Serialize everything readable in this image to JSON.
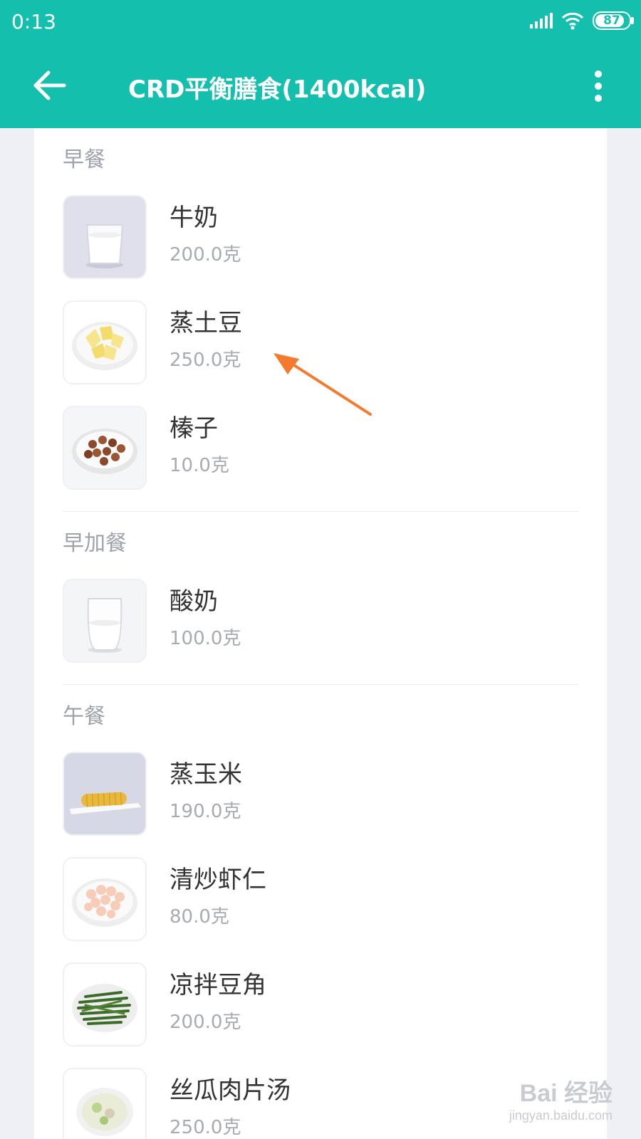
{
  "status_bar": {
    "time": "0:13",
    "battery": "87",
    "icons": [
      "signal-icon",
      "wifi-icon",
      "battery-icon"
    ]
  },
  "app_bar": {
    "title": "CRD平衡膳食(1400kcal)",
    "background": "#15bfae"
  },
  "sections": [
    {
      "title": "早餐",
      "items": [
        {
          "name": "牛奶",
          "amount": "200.0克",
          "icon": "milk-glass-icon"
        },
        {
          "name": "蒸土豆",
          "amount": "250.0克",
          "icon": "steamed-potato-icon"
        },
        {
          "name": "榛子",
          "amount": "10.0克",
          "icon": "hazelnut-icon"
        }
      ]
    },
    {
      "title": "早加餐",
      "items": [
        {
          "name": "酸奶",
          "amount": "100.0克",
          "icon": "yogurt-glass-icon"
        }
      ]
    },
    {
      "title": "午餐",
      "items": [
        {
          "name": "蒸玉米",
          "amount": "190.0克",
          "icon": "corn-icon"
        },
        {
          "name": "清炒虾仁",
          "amount": "80.0克",
          "icon": "shrimp-icon"
        },
        {
          "name": "凉拌豆角",
          "amount": "200.0克",
          "icon": "green-beans-icon"
        },
        {
          "name": "丝瓜肉片汤",
          "amount": "250.0克",
          "icon": "soup-icon"
        }
      ]
    }
  ],
  "watermark": {
    "main": "Bai 经验",
    "sub": "jingyan.baidu.com"
  },
  "annotation": {
    "color": "#f47a30"
  }
}
